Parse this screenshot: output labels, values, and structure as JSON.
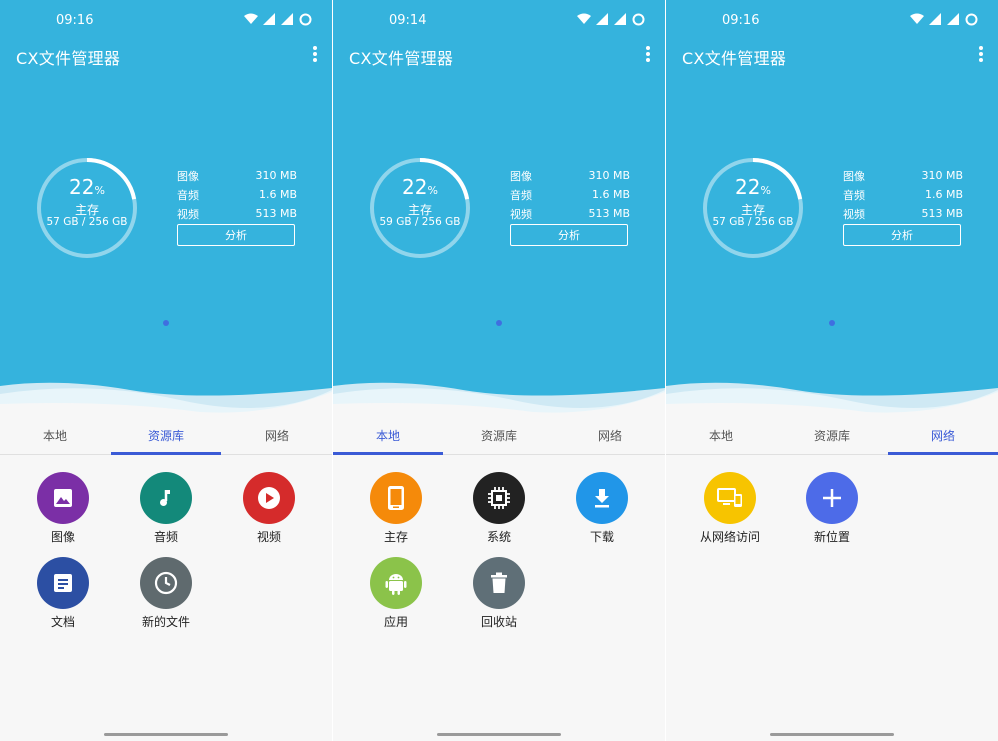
{
  "app_title": "CX文件管理器",
  "colors": {
    "hero": "#35b3dd",
    "accent": "#3b5bd6"
  },
  "storage": {
    "percent": "22",
    "percent_symbol": "%",
    "percent_value": 22,
    "label": "主存",
    "stats": [
      {
        "label": "图像",
        "value": "310 MB"
      },
      {
        "label": "音频",
        "value": "1.6 MB"
      },
      {
        "label": "视频",
        "value": "513 MB"
      }
    ],
    "analyze_label": "分析"
  },
  "tab_labels": {
    "local": "本地",
    "library": "资源库",
    "network": "网络"
  },
  "panels": [
    {
      "time": "09:16",
      "storage_size": "57 GB / 256 GB",
      "active_tab": "library",
      "items": [
        {
          "label": "图像",
          "icon": "image-icon",
          "color": "#7b2fa6"
        },
        {
          "label": "音频",
          "icon": "music-note-icon",
          "color": "#13897a"
        },
        {
          "label": "视频",
          "icon": "play-icon",
          "color": "#d52b2b"
        },
        {
          "label": "文档",
          "icon": "document-icon",
          "color": "#2c4fa3"
        },
        {
          "label": "新的文件",
          "icon": "clock-icon",
          "color": "#5f6a6e"
        }
      ]
    },
    {
      "time": "09:14",
      "storage_size": "59 GB / 256 GB",
      "active_tab": "local",
      "items": [
        {
          "label": "主存",
          "icon": "phone-icon",
          "color": "#f58a0a"
        },
        {
          "label": "系统",
          "icon": "chip-icon",
          "color": "#222222"
        },
        {
          "label": "下载",
          "icon": "download-icon",
          "color": "#2196e8"
        },
        {
          "label": "应用",
          "icon": "android-icon",
          "color": "#8bc34a"
        },
        {
          "label": "回收站",
          "icon": "trash-icon",
          "color": "#5f6f77"
        }
      ]
    },
    {
      "time": "09:16",
      "storage_size": "57 GB / 256 GB",
      "active_tab": "network",
      "items": [
        {
          "label": "从网络访问",
          "icon": "devices-icon",
          "color": "#f7c400"
        },
        {
          "label": "新位置",
          "icon": "plus-icon",
          "color": "#4d6be8"
        }
      ]
    }
  ]
}
